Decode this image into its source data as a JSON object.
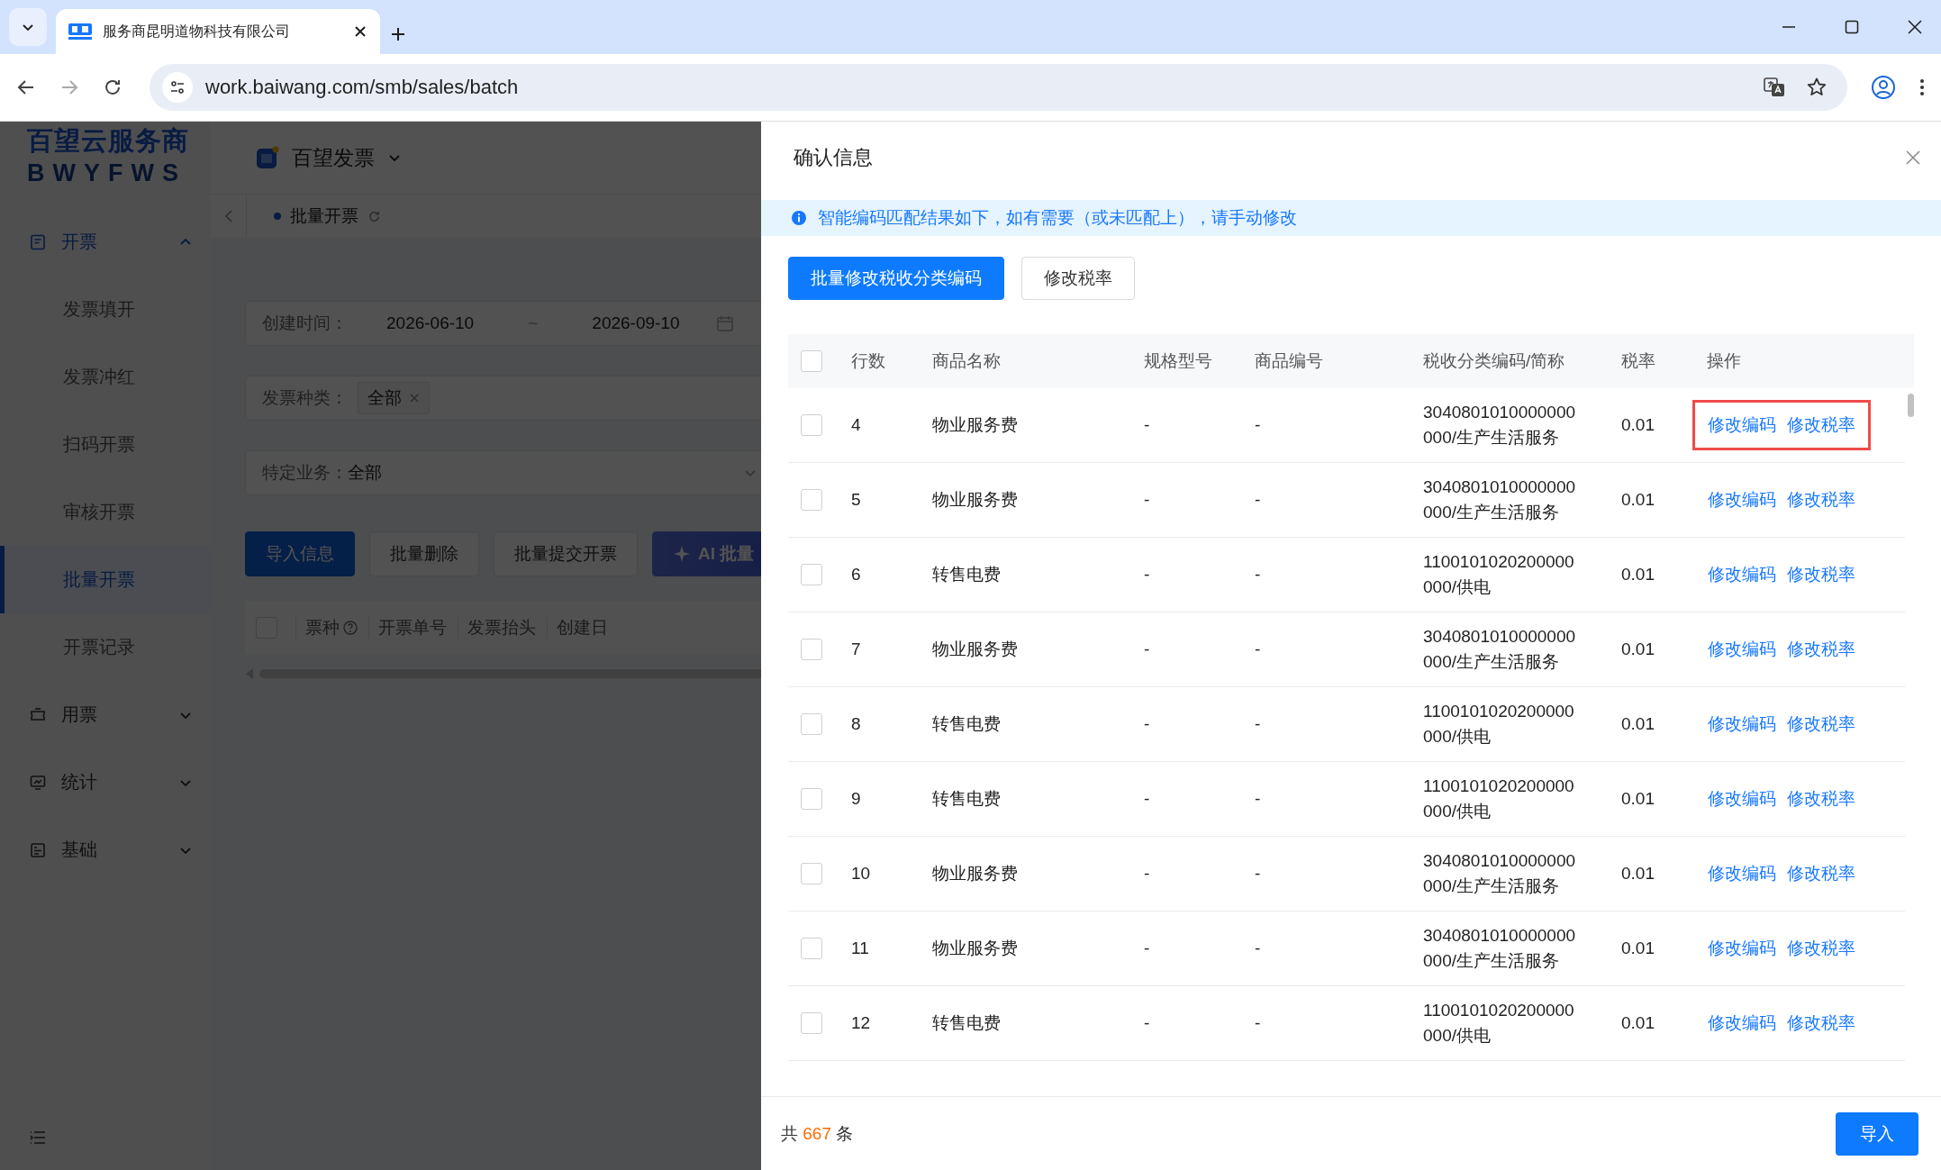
{
  "browser": {
    "tab_title": "服务商昆明道物科技有限公司",
    "url": "work.baiwang.com/smb/sales/batch"
  },
  "sidebar": {
    "logo_title": "百望云服务商",
    "logo_subtitle": "BWYFWS",
    "items": [
      {
        "label": "开票",
        "kind": "doc",
        "selected": true,
        "expanded": true,
        "children": [
          {
            "label": "发票填开",
            "selected": false
          },
          {
            "label": "发票冲红",
            "selected": false
          },
          {
            "label": "扫码开票",
            "selected": false
          },
          {
            "label": "审核开票",
            "selected": false
          },
          {
            "label": "批量开票",
            "selected": true
          },
          {
            "label": "开票记录",
            "selected": false
          }
        ]
      },
      {
        "label": "用票",
        "kind": "ticket",
        "selected": false,
        "expanded": false
      },
      {
        "label": "统计",
        "kind": "chart",
        "selected": false,
        "expanded": false
      },
      {
        "label": "基础",
        "kind": "form",
        "selected": false,
        "expanded": false
      }
    ]
  },
  "main": {
    "app_name": "百望发票",
    "page_tab": "批量开票",
    "filters": [
      {
        "kind": "daterange",
        "label": "创建时间：",
        "start": "2026-06-10",
        "separator": "~",
        "end": "2026-09-10"
      },
      {
        "kind": "tags",
        "label": "发票种类：",
        "tags": [
          "全部"
        ]
      },
      {
        "kind": "select",
        "label": "特定业务：",
        "value": "全部"
      }
    ],
    "buttons": [
      {
        "kind": "primary",
        "label": "导入信息"
      },
      {
        "kind": "default",
        "label": "批量删除"
      },
      {
        "kind": "default",
        "label": "批量提交开票"
      },
      {
        "kind": "ai",
        "label": "AI 批量"
      }
    ],
    "table": {
      "all_checked": false,
      "columns": [
        {
          "label": "票种",
          "help": true
        },
        {
          "label": "开票单号",
          "help": false
        },
        {
          "label": "发票抬头",
          "help": false
        },
        {
          "label": "创建日",
          "help": false
        }
      ]
    }
  },
  "drawer": {
    "title": "确认信息",
    "notice": "智能编码匹配结果如下，如有需要（或未匹配上），请手动修改",
    "buttons": [
      {
        "kind": "primary",
        "label": "批量修改税收分类编码"
      },
      {
        "kind": "default",
        "label": "修改税率"
      }
    ],
    "table": {
      "all_checked": false,
      "columns": [
        "行数",
        "商品名称",
        "规格型号",
        "商品编号",
        "税收分类编码/简称",
        "税率",
        "操作"
      ],
      "rows": [
        {
          "checked": false,
          "line": "4",
          "name": "物业服务费",
          "spec": "-",
          "code": "-",
          "tax_code": "3040801010000000000/生产生活服务",
          "rate": "0.01",
          "actions": [
            "修改编码",
            "修改税率"
          ],
          "highlighted": true
        },
        {
          "checked": false,
          "line": "5",
          "name": "物业服务费",
          "spec": "-",
          "code": "-",
          "tax_code": "3040801010000000000/生产生活服务",
          "rate": "0.01",
          "actions": [
            "修改编码",
            "修改税率"
          ],
          "highlighted": false
        },
        {
          "checked": false,
          "line": "6",
          "name": "转售电费",
          "spec": "-",
          "code": "-",
          "tax_code": "1100101020200000000/供电",
          "rate": "0.01",
          "actions": [
            "修改编码",
            "修改税率"
          ],
          "highlighted": false
        },
        {
          "checked": false,
          "line": "7",
          "name": "物业服务费",
          "spec": "-",
          "code": "-",
          "tax_code": "3040801010000000000/生产生活服务",
          "rate": "0.01",
          "actions": [
            "修改编码",
            "修改税率"
          ],
          "highlighted": false
        },
        {
          "checked": false,
          "line": "8",
          "name": "转售电费",
          "spec": "-",
          "code": "-",
          "tax_code": "1100101020200000000/供电",
          "rate": "0.01",
          "actions": [
            "修改编码",
            "修改税率"
          ],
          "highlighted": false
        },
        {
          "checked": false,
          "line": "9",
          "name": "转售电费",
          "spec": "-",
          "code": "-",
          "tax_code": "1100101020200000000/供电",
          "rate": "0.01",
          "actions": [
            "修改编码",
            "修改税率"
          ],
          "highlighted": false
        },
        {
          "checked": false,
          "line": "10",
          "name": "物业服务费",
          "spec": "-",
          "code": "-",
          "tax_code": "3040801010000000000/生产生活服务",
          "rate": "0.01",
          "actions": [
            "修改编码",
            "修改税率"
          ],
          "highlighted": false
        },
        {
          "checked": false,
          "line": "11",
          "name": "物业服务费",
          "spec": "-",
          "code": "-",
          "tax_code": "3040801010000000000/生产生活服务",
          "rate": "0.01",
          "actions": [
            "修改编码",
            "修改税率"
          ],
          "highlighted": false
        },
        {
          "checked": false,
          "line": "12",
          "name": "转售电费",
          "spec": "-",
          "code": "-",
          "tax_code": "1100101020200000000/供电",
          "rate": "0.01",
          "actions": [
            "修改编码",
            "修改税率"
          ],
          "highlighted": false
        }
      ]
    },
    "footer": {
      "prefix": "共",
      "count": "667",
      "suffix": "条"
    },
    "confirm": "导入"
  }
}
